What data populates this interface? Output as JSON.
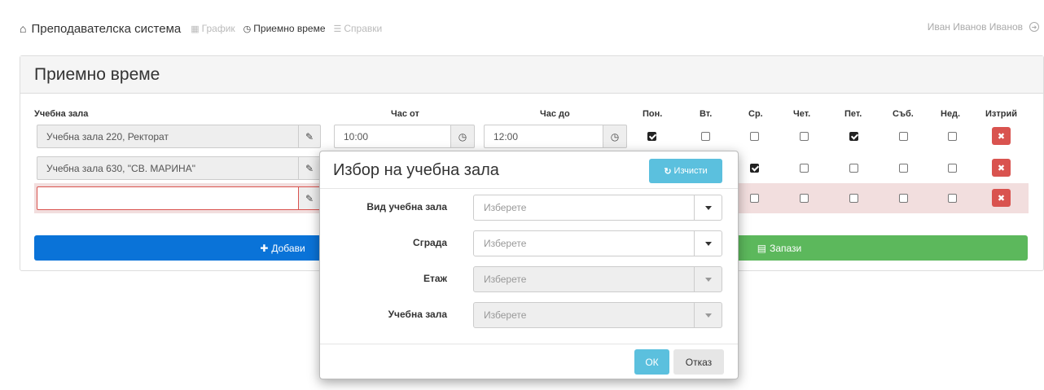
{
  "navbar": {
    "brand": "Преподавателска система",
    "links": [
      {
        "label": "График",
        "state": "disabled",
        "icon": "calendar-icon"
      },
      {
        "label": "Приемно време",
        "state": "active",
        "icon": "clock-icon"
      },
      {
        "label": "Справки",
        "state": "disabled",
        "icon": "list-icon"
      }
    ],
    "user": "Иван Иванов Иванов"
  },
  "page": {
    "title": "Приемно време"
  },
  "table": {
    "headers": {
      "room": "Учебна зала",
      "from": "Час от",
      "to": "Час до",
      "days": [
        "Пон.",
        "Вт.",
        "Ср.",
        "Чет.",
        "Пет.",
        "Съб.",
        "Нед."
      ],
      "delete": "Изтрий"
    },
    "rows": [
      {
        "room": "Учебна зала 220, Ректорат",
        "from": "10:00",
        "to": "12:00",
        "days": [
          true,
          false,
          false,
          false,
          true,
          false,
          false
        ]
      },
      {
        "room": "Учебна зала 630, \"СВ. МАРИНА\"",
        "from": "",
        "to": "",
        "days": [
          false,
          false,
          true,
          false,
          false,
          false,
          false
        ]
      },
      {
        "room": "",
        "from": "",
        "to": "",
        "days": [
          false,
          false,
          false,
          false,
          false,
          false,
          false
        ],
        "error": true
      }
    ]
  },
  "buttons": {
    "add": "Добави",
    "save": "Запази"
  },
  "modal": {
    "title": "Избор на учебна зала",
    "clear": "Изчисти",
    "fields": [
      {
        "label": "Вид учебна зала",
        "placeholder": "Изберете",
        "disabled": false
      },
      {
        "label": "Сграда",
        "placeholder": "Изберете",
        "disabled": false
      },
      {
        "label": "Етаж",
        "placeholder": "Изберете",
        "disabled": true
      },
      {
        "label": "Учебна зала",
        "placeholder": "Изберете",
        "disabled": true
      }
    ],
    "ok": "ОК",
    "cancel": "Отказ"
  },
  "colors": {
    "primary": "#0a73d8",
    "success": "#5cb85c",
    "info": "#5bc0de",
    "danger": "#d9534f",
    "error_row": "#f2dede"
  }
}
